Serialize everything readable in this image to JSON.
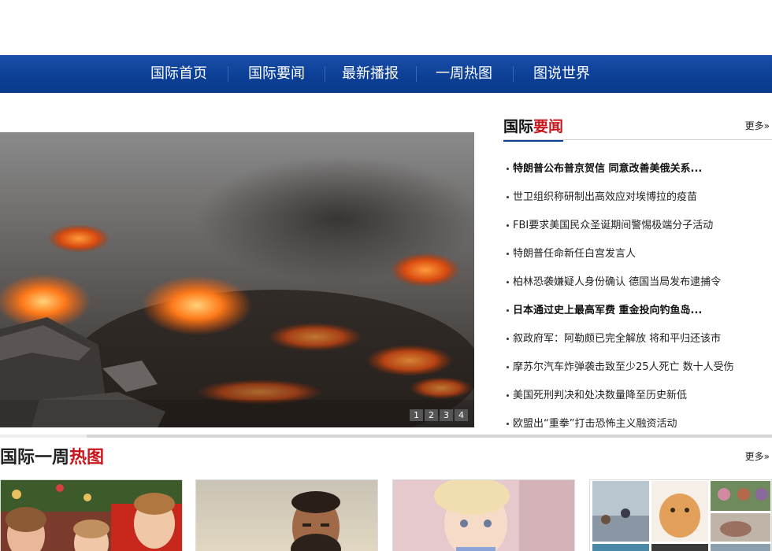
{
  "nav": {
    "items": [
      "国际首页",
      "国际要闻",
      "最新播报",
      "一周热图",
      "图说世界"
    ]
  },
  "hero": {
    "slide_numbers": [
      "1",
      "2",
      "3",
      "4"
    ]
  },
  "news_section": {
    "title_black": "国际",
    "title_red": "要闻",
    "more_label": "更多»",
    "items": [
      {
        "text": "特朗普公布普京贺信 同意改善美俄关系...",
        "bold": true
      },
      {
        "text": "世卫组织称研制出高效应对埃博拉的疫苗",
        "bold": false
      },
      {
        "text": "FBI要求美国民众圣诞期间警惕极端分子活动",
        "bold": false
      },
      {
        "text": "特朗普任命新任白宫发言人",
        "bold": false
      },
      {
        "text": "柏林恐袭嫌疑人身份确认 德国当局发布逮捕令",
        "bold": false
      },
      {
        "text": "日本通过史上最高军费 重金投向钓鱼岛...",
        "bold": true
      },
      {
        "text": "叙政府军：阿勒颇已完全解放 将和平归还该市",
        "bold": false
      },
      {
        "text": "摩苏尔汽车炸弹袭击致至少25人死亡 数十人受伤",
        "bold": false
      },
      {
        "text": "美国死刑判决和处决数量降至历史新低",
        "bold": false
      },
      {
        "text": "欧盟出“重拳”打击恐怖主义融资活动",
        "bold": false
      }
    ]
  },
  "week_section": {
    "title_black": "国际一周",
    "title_red": "热图",
    "more_label": "更多»"
  },
  "colors": {
    "nav_blue": "#0c3f96",
    "accent_red": "#c8161d"
  }
}
